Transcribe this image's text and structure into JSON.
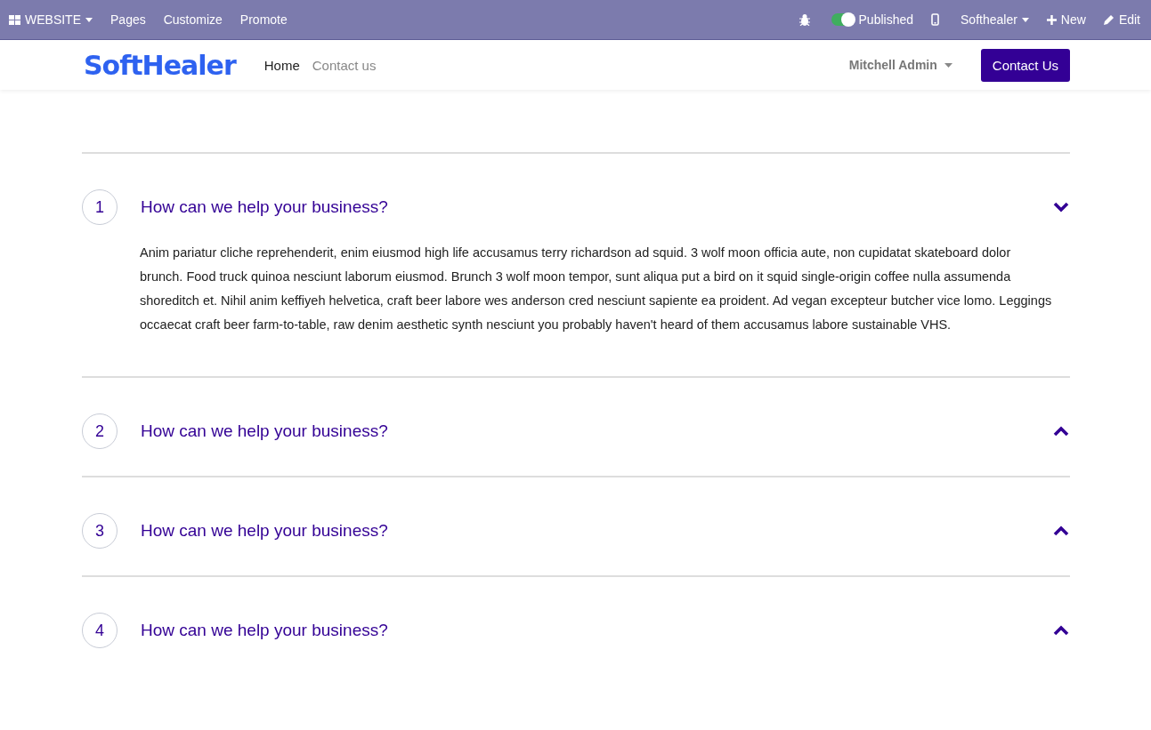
{
  "admin_bar": {
    "app_menu": "WEBSITE",
    "menu": [
      "Pages",
      "Customize",
      "Promote"
    ],
    "published": {
      "label": "Published",
      "on": true
    },
    "website_switcher": "Softhealer",
    "new": "New",
    "edit": "Edit"
  },
  "header": {
    "logo": "SoftHealer",
    "nav": [
      {
        "label": "Home",
        "selected": true
      },
      {
        "label": "Contact us",
        "selected": false
      }
    ],
    "user": "Mitchell Admin",
    "cta": "Contact Us"
  },
  "faq": [
    {
      "number": "1",
      "question": "How can we help your business?",
      "expanded": true,
      "answer": "Anim pariatur cliche reprehenderit, enim eiusmod high life accusamus terry richardson ad squid. 3 wolf moon officia aute, non cupidatat skateboard dolor brunch. Food truck quinoa nesciunt laborum eiusmod. Brunch 3 wolf moon tempor, sunt aliqua put a bird on it squid single-origin coffee nulla assumenda shoreditch et. Nihil anim keffiyeh helvetica, craft beer labore wes anderson cred nesciunt sapiente ea proident. Ad vegan excepteur butcher vice lomo. Leggings occaecat craft beer farm-to-table, raw denim aesthetic synth nesciunt you probably haven't heard of them accusamus labore sustainable VHS."
    },
    {
      "number": "2",
      "question": "How can we help your business?",
      "expanded": false
    },
    {
      "number": "3",
      "question": "How can we help your business?",
      "expanded": false
    },
    {
      "number": "4",
      "question": "How can we help your business?",
      "expanded": false
    }
  ]
}
